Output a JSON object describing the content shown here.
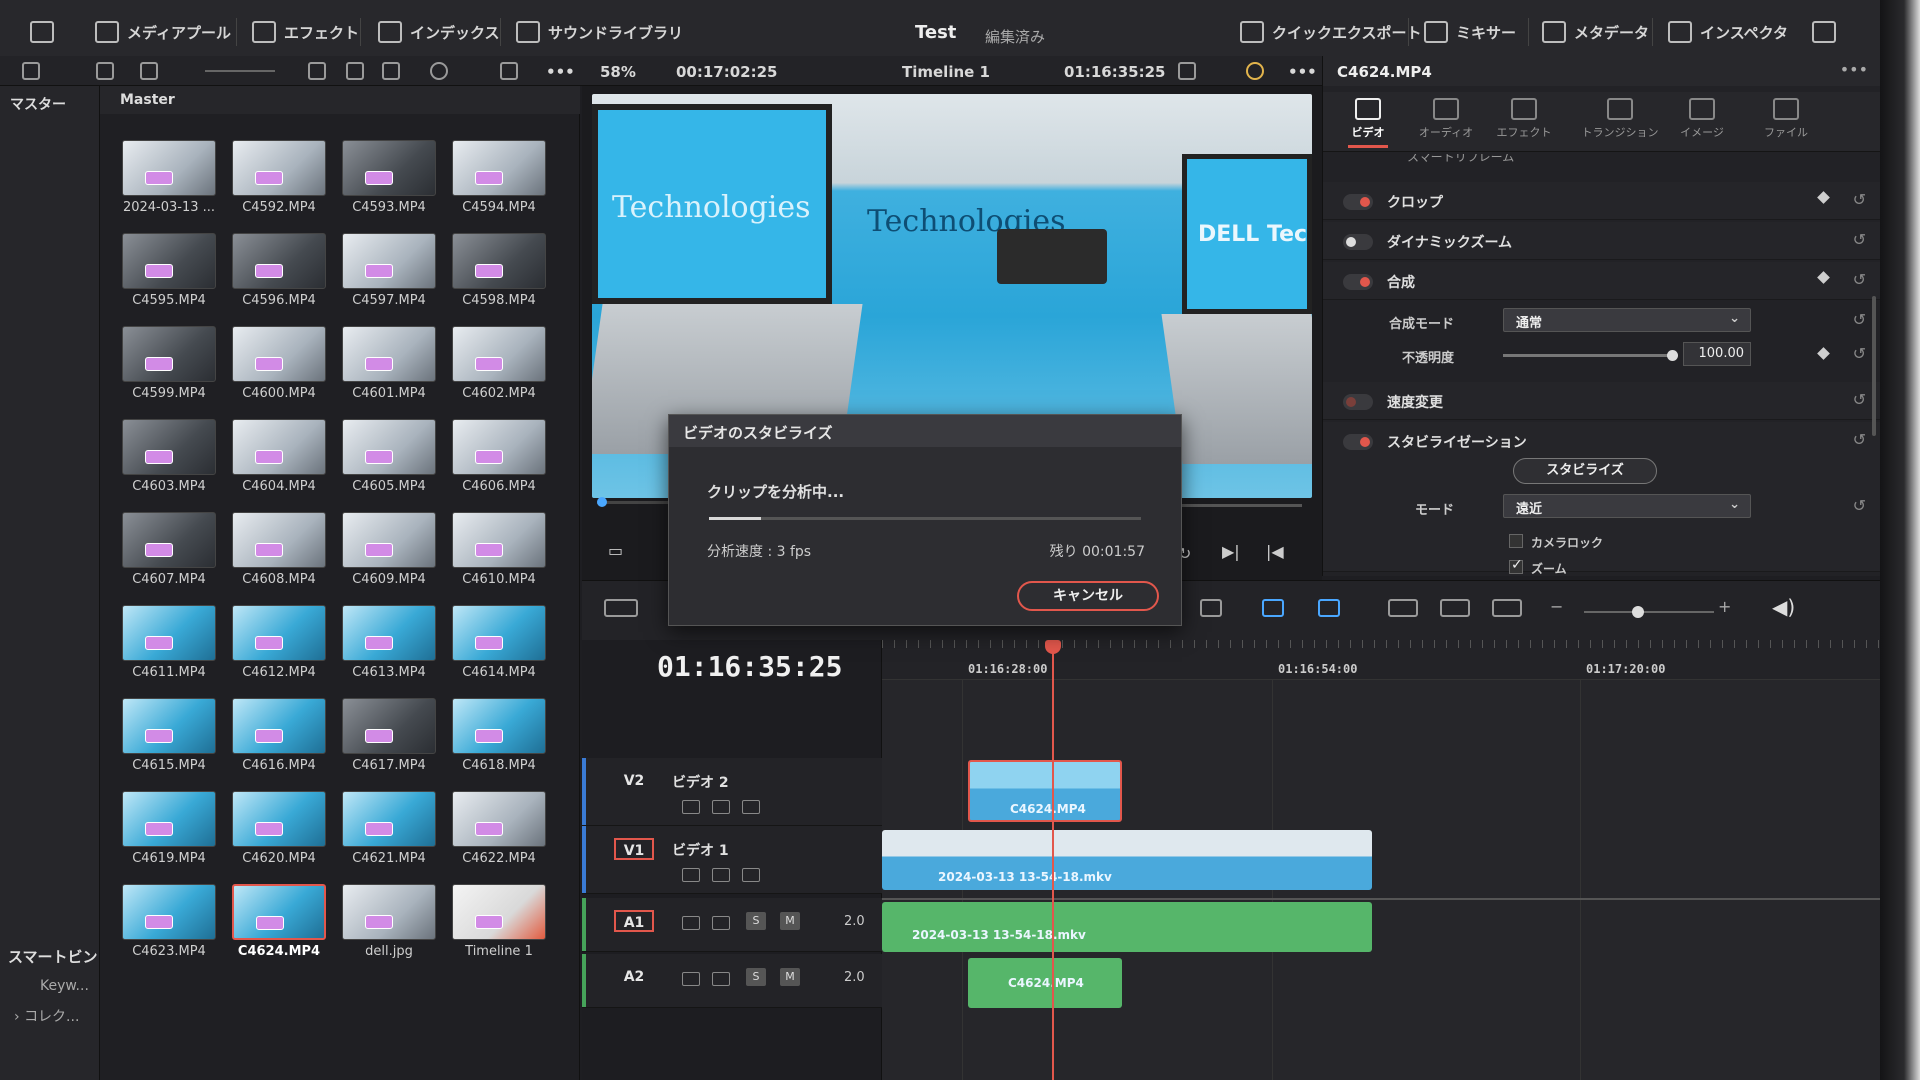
{
  "toolbar": {
    "media_pool": "メディアプール",
    "effects": "エフェクト",
    "index": "インデックス",
    "sound_library": "サウンドライブラリ",
    "project_title": "Test",
    "project_status": "編集済み",
    "quick_export": "クイックエクスポート",
    "mixer": "ミキサー",
    "metadata": "メタデータ",
    "inspector": "インスペクタ"
  },
  "viewer_bar": {
    "zoom": "58%",
    "source_timecode": "00:17:02:25",
    "timeline_name": "Timeline 1",
    "record_timecode": "01:16:35:25"
  },
  "sidebar": {
    "master_label": "マスター",
    "smart_bins": "スマートビン",
    "keywords": "Keyw...",
    "collections": "コレク..."
  },
  "pool": {
    "header": "Master",
    "clips": [
      {
        "name": "2024-03-13 ...",
        "style": "light"
      },
      {
        "name": "C4592.MP4",
        "style": "light"
      },
      {
        "name": "C4593.MP4",
        "style": "dark"
      },
      {
        "name": "C4594.MP4",
        "style": "light"
      },
      {
        "name": "C4595.MP4",
        "style": "dark"
      },
      {
        "name": "C4596.MP4",
        "style": "dark"
      },
      {
        "name": "C4597.MP4",
        "style": "light"
      },
      {
        "name": "C4598.MP4",
        "style": "dark"
      },
      {
        "name": "C4599.MP4",
        "style": "dark"
      },
      {
        "name": "C4600.MP4",
        "style": "light"
      },
      {
        "name": "C4601.MP4",
        "style": "light"
      },
      {
        "name": "C4602.MP4",
        "style": "light"
      },
      {
        "name": "C4603.MP4",
        "style": "dark"
      },
      {
        "name": "C4604.MP4",
        "style": "light"
      },
      {
        "name": "C4605.MP4",
        "style": "light"
      },
      {
        "name": "C4606.MP4",
        "style": "light"
      },
      {
        "name": "C4607.MP4",
        "style": "dark"
      },
      {
        "name": "C4608.MP4",
        "style": "light"
      },
      {
        "name": "C4609.MP4",
        "style": "light"
      },
      {
        "name": "C4610.MP4",
        "style": "light"
      },
      {
        "name": "C4611.MP4",
        "style": "blue"
      },
      {
        "name": "C4612.MP4",
        "style": "blue"
      },
      {
        "name": "C4613.MP4",
        "style": "blue"
      },
      {
        "name": "C4614.MP4",
        "style": "blue"
      },
      {
        "name": "C4615.MP4",
        "style": "blue"
      },
      {
        "name": "C4616.MP4",
        "style": "blue"
      },
      {
        "name": "C4617.MP4",
        "style": "dark"
      },
      {
        "name": "C4618.MP4",
        "style": "blue"
      },
      {
        "name": "C4619.MP4",
        "style": "blue"
      },
      {
        "name": "C4620.MP4",
        "style": "blue"
      },
      {
        "name": "C4621.MP4",
        "style": "blue"
      },
      {
        "name": "C4622.MP4",
        "style": "light"
      },
      {
        "name": "C4623.MP4",
        "style": "blue"
      },
      {
        "name": "C4624.MP4",
        "style": "blue",
        "selected": true
      },
      {
        "name": "dell.jpg",
        "style": "light"
      },
      {
        "name": "Timeline 1",
        "style": "photo"
      }
    ]
  },
  "viewer": {
    "sign_left": "Technologies",
    "sign_center": "Technologies",
    "sign_right": "DELL Tec"
  },
  "dialog": {
    "title": "ビデオのスタビライズ",
    "message": "クリップを分析中...",
    "progress": 0.12,
    "speed": "分析速度 : 3 fps",
    "remaining": "残り 00:01:57",
    "cancel": "キャンセル"
  },
  "inspector": {
    "clip_name": "C4624.MP4",
    "tabs": [
      "ビデオ",
      "オーディオ",
      "エフェクト",
      "トランジション",
      "イメージ",
      "ファイル"
    ],
    "clipped_header": "スマートリフレーム",
    "sections": {
      "crop": "クロップ",
      "dynamic_zoom": "ダイナミックズーム",
      "composite": "合成",
      "composite_mode_label": "合成モード",
      "composite_mode_value": "通常",
      "opacity_label": "不透明度",
      "opacity_value": "100.00",
      "speed_change": "速度変更",
      "stabilization": "スタビライゼーション",
      "stabilize_button": "スタビライズ",
      "mode_label": "モード",
      "mode_value": "遠近",
      "camera_lock": "カメラロック",
      "zoom": "ズーム"
    }
  },
  "timeline": {
    "timecode": "01:16:35:25",
    "ruler": [
      "01:16:28:00",
      "01:16:54:00",
      "01:17:20:00"
    ],
    "tracks": [
      {
        "code": "V2",
        "name": "ビデオ 2"
      },
      {
        "code": "V1",
        "name": "ビデオ 1"
      },
      {
        "code": "A1",
        "vol": "2.0"
      },
      {
        "code": "A2",
        "vol": "2.0"
      }
    ],
    "clips": {
      "v2": "C4624.MP4",
      "v1": "2024-03-13 13-54-18.mkv",
      "a1": "2024-03-13 13-54-18.mkv",
      "a2": "C4624.MP4"
    }
  },
  "colors": {
    "accent_red": "#e2574c",
    "video_clip": "#4aa9dc",
    "audio_clip": "#56b66a"
  }
}
